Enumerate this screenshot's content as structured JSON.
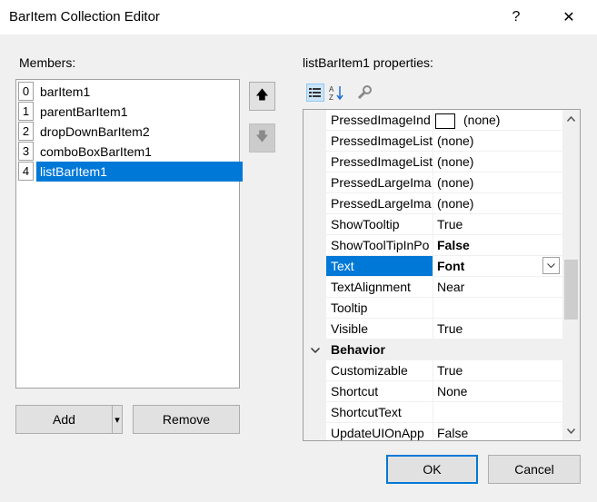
{
  "window": {
    "title": "BarItem Collection Editor",
    "help": "?",
    "close": "✕"
  },
  "members": {
    "label": "Members:",
    "items": [
      {
        "index": "0",
        "name": "barItem1"
      },
      {
        "index": "1",
        "name": "parentBarItem1"
      },
      {
        "index": "2",
        "name": "dropDownBarItem2"
      },
      {
        "index": "3",
        "name": "comboBoxBarItem1"
      },
      {
        "index": "4",
        "name": "listBarItem1"
      }
    ],
    "selected_index": 4
  },
  "arrows": {
    "up": "🡅",
    "down": "🡇"
  },
  "buttons": {
    "add": "Add",
    "add_dropdown": "▾",
    "remove": "Remove",
    "ok": "OK",
    "cancel": "Cancel"
  },
  "properties": {
    "label": "listBarItem1 properties:",
    "toolbar_icons": [
      "categorized-icon",
      "alphabetical-icon",
      "property-pages-icon"
    ],
    "rows": [
      {
        "name": "PressedImageInd",
        "value": "(none)"
      },
      {
        "name": "PressedImageList",
        "value": "(none)"
      },
      {
        "name": "PressedImageList",
        "value": "(none)"
      },
      {
        "name": "PressedLargeIma",
        "value": "(none)"
      },
      {
        "name": "PressedLargeIma",
        "value": "(none)"
      },
      {
        "name": "ShowTooltip",
        "value": "True"
      },
      {
        "name": "ShowToolTipInPo",
        "value": "False"
      },
      {
        "name": "Text",
        "value": "Font"
      },
      {
        "name": "TextAlignment",
        "value": "Near"
      },
      {
        "name": "Tooltip",
        "value": ""
      },
      {
        "name": "Visible",
        "value": "True"
      },
      {
        "name": "Behavior",
        "value": ""
      },
      {
        "name": "Customizable",
        "value": "True"
      },
      {
        "name": "Shortcut",
        "value": "None"
      },
      {
        "name": "ShortcutText",
        "value": ""
      },
      {
        "name": "UpdateUIOnApp",
        "value": "False"
      }
    ],
    "selected_row": 7,
    "category_collapse_glyph": "⌄",
    "scroll_up": "︿",
    "scroll_down": "﹀"
  },
  "colors": {
    "selection": "#0078d7",
    "dialog_bg": "#f0f0f0"
  }
}
